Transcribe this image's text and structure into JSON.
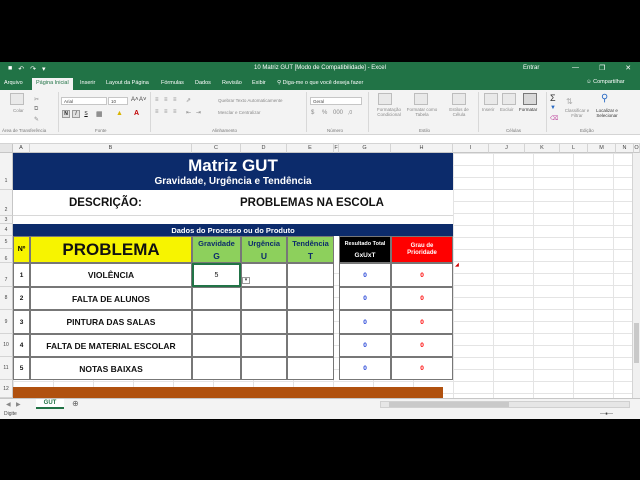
{
  "app": {
    "window_title": "10 Matriz GUT  [Modo de Compatibilidade]  -  Excel",
    "signin": "Entrar",
    "share": "Compartilhar"
  },
  "tabs": [
    "Arquivo",
    "Página Inicial",
    "Inserir",
    "Layout da Página",
    "Fórmulas",
    "Dados",
    "Revisão",
    "Exibir"
  ],
  "tellme": "Diga-me o que você deseja fazer",
  "ribbon": {
    "paste_label": "Colar",
    "font_name": "Arial",
    "font_size": "10",
    "wrap_text": "Quebrar Texto Automaticamente",
    "merge_center": "Mesclar e Centralizar",
    "number_format": "Geral",
    "cond_format": "Formatação Condicional",
    "format_table": "Formatar como Tabela",
    "cell_styles": "Estilos de Célula",
    "insert": "Inserir",
    "delete": "Excluir",
    "format": "Formatar",
    "sort_filter": "Classificar e Filtrar",
    "find_select": "Localizar e Selecionar",
    "groups": [
      "Área de Transferência",
      "Fonte",
      "Alinhamento",
      "Número",
      "Estilo",
      "Células",
      "Edição"
    ]
  },
  "columns": [
    "A",
    "B",
    "C",
    "D",
    "E",
    "F",
    "G",
    "H",
    "I",
    "J",
    "K",
    "L",
    "M",
    "N",
    "O"
  ],
  "rows": [
    "1",
    "2",
    "3",
    "4",
    "5",
    "6",
    "7",
    "8",
    "9",
    "10",
    "11",
    "12"
  ],
  "sheet": {
    "title": "Matriz GUT",
    "subtitle": "Gravidade, Urgência e Tendência",
    "descricao_label": "DESCRIÇÃO:",
    "descricao_value": "PROBLEMAS NA ESCOLA",
    "section": "Dados do Processo ou do Produto",
    "header": {
      "num": "Nº",
      "problema": "PROBLEMA",
      "gravidade": "Gravidade",
      "g": "G",
      "urgencia": "Urgência",
      "u": "U",
      "tendencia": "Tendência",
      "t": "T",
      "resultado": "Resultado Total",
      "gxuxt": "GxUxT",
      "grau": "Grau de Prioridade"
    },
    "items": [
      {
        "n": "1",
        "problema": "VIOLÊNCIA",
        "g": "5",
        "u": "",
        "t": "",
        "resultado": "0",
        "grau": "0"
      },
      {
        "n": "2",
        "problema": "FALTA DE ALUNOS",
        "g": "",
        "u": "",
        "t": "",
        "resultado": "0",
        "grau": "0"
      },
      {
        "n": "3",
        "problema": "PINTURA DAS SALAS",
        "g": "",
        "u": "",
        "t": "",
        "resultado": "0",
        "grau": "0"
      },
      {
        "n": "4",
        "problema": "FALTA DE MATERIAL ESCOLAR",
        "g": "",
        "u": "",
        "t": "",
        "resultado": "0",
        "grau": "0"
      },
      {
        "n": "5",
        "problema": "NOTAS BAIXAS",
        "g": "",
        "u": "",
        "t": "",
        "resultado": "0",
        "grau": "0"
      }
    ]
  },
  "sheet_tab": "GUT",
  "status": "Digite",
  "colors": {
    "excel_green": "#217346",
    "navy": "#0c2b6b",
    "yellow": "#f7f400",
    "green": "#8dd05c",
    "red": "#ff0000",
    "blue_num": "#1f3fd6",
    "brown": "#b0510f"
  }
}
